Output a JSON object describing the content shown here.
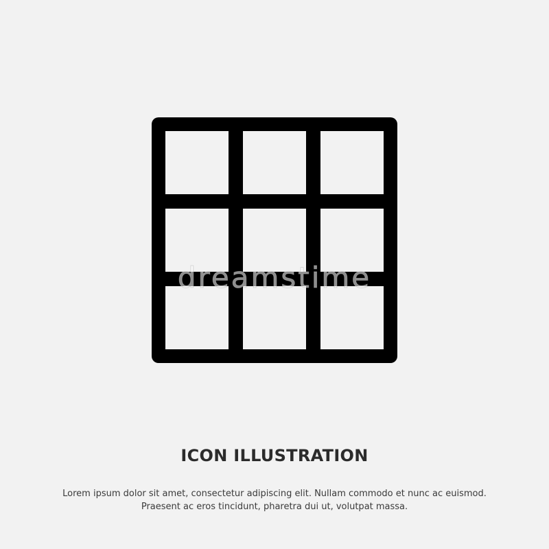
{
  "icon": {
    "name": "grid-3x3-icon",
    "rows": 3,
    "cols": 3,
    "stroke_color": "#000000"
  },
  "background_color": "#f2f2f2",
  "watermark": "dreamstime",
  "caption": {
    "title": "ICON ILLUSTRATION",
    "lines": [
      "Lorem ipsum dolor sit amet, consectetur adipiscing elit. Nullam commodo et nunc ac euismod.",
      "Praesent ac eros tincidunt, pharetra dui ut, volutpat massa."
    ]
  }
}
